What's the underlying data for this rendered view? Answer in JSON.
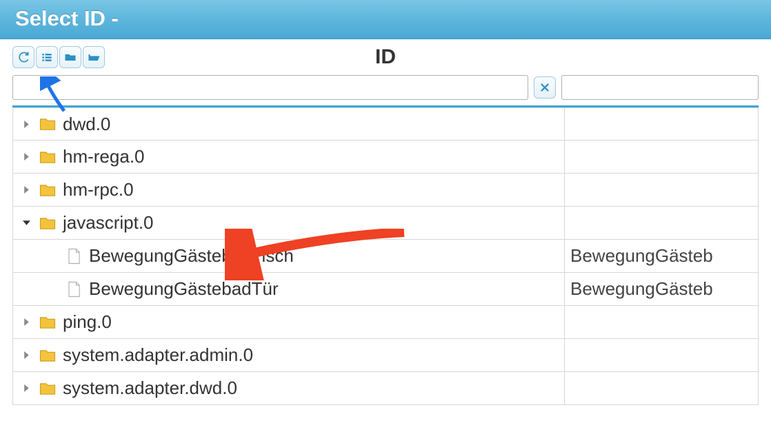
{
  "dialog": {
    "title": "Select ID -"
  },
  "column_header": "ID",
  "filter": {
    "id_value": "",
    "name_value": ""
  },
  "tree": [
    {
      "type": "folder",
      "expanded": false,
      "indent": 0,
      "id": "dwd.0",
      "name": ""
    },
    {
      "type": "folder",
      "expanded": false,
      "indent": 0,
      "id": "hm-rega.0",
      "name": ""
    },
    {
      "type": "folder",
      "expanded": false,
      "indent": 0,
      "id": "hm-rpc.0",
      "name": ""
    },
    {
      "type": "folder",
      "expanded": true,
      "indent": 0,
      "id": "javascript.0",
      "name": ""
    },
    {
      "type": "file",
      "expanded": null,
      "indent": 1,
      "id": "BewegungGästebadTisch",
      "name": "BewegungGästeb"
    },
    {
      "type": "file",
      "expanded": null,
      "indent": 1,
      "id": "BewegungGästebadTür",
      "name": "BewegungGästeb"
    },
    {
      "type": "folder",
      "expanded": false,
      "indent": 0,
      "id": "ping.0",
      "name": ""
    },
    {
      "type": "folder",
      "expanded": false,
      "indent": 0,
      "id": "system.adapter.admin.0",
      "name": ""
    },
    {
      "type": "folder",
      "expanded": false,
      "indent": 0,
      "id": "system.adapter.dwd.0",
      "name": ""
    }
  ]
}
